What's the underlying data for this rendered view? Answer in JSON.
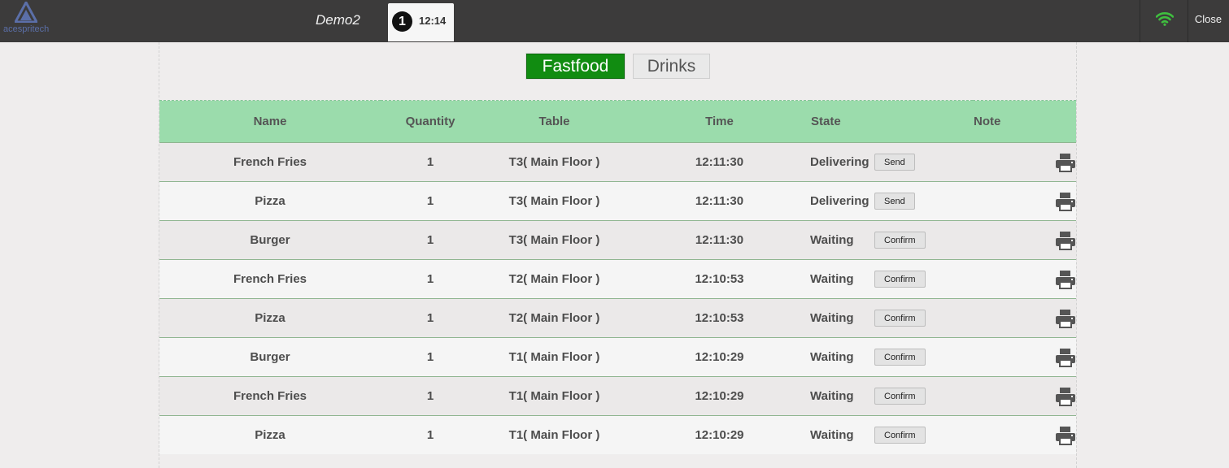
{
  "header": {
    "logo_text": "acespritech",
    "user_name": "Demo2",
    "badge_count": "1",
    "clock": "12:14",
    "close_label": "Close",
    "wifi_color": "#3fbf3f"
  },
  "tabs": [
    {
      "label": "Fastfood",
      "active": true
    },
    {
      "label": "Drinks",
      "active": false
    }
  ],
  "table": {
    "columns": [
      "Name",
      "Quantity",
      "Table",
      "Time",
      "State",
      "Note"
    ],
    "rows": [
      {
        "name": "French Fries",
        "qty": "1",
        "table": "T3( Main Floor )",
        "time": "12:11:30",
        "state": "Delivering",
        "action": "Send"
      },
      {
        "name": "Pizza",
        "qty": "1",
        "table": "T3( Main Floor )",
        "time": "12:11:30",
        "state": "Delivering",
        "action": "Send"
      },
      {
        "name": "Burger",
        "qty": "1",
        "table": "T3( Main Floor )",
        "time": "12:11:30",
        "state": "Waiting",
        "action": "Confirm"
      },
      {
        "name": "French Fries",
        "qty": "1",
        "table": "T2( Main Floor )",
        "time": "12:10:53",
        "state": "Waiting",
        "action": "Confirm"
      },
      {
        "name": "Pizza",
        "qty": "1",
        "table": "T2( Main Floor )",
        "time": "12:10:53",
        "state": "Waiting",
        "action": "Confirm"
      },
      {
        "name": "Burger",
        "qty": "1",
        "table": "T1( Main Floor )",
        "time": "12:10:29",
        "state": "Waiting",
        "action": "Confirm"
      },
      {
        "name": "French Fries",
        "qty": "1",
        "table": "T1( Main Floor )",
        "time": "12:10:29",
        "state": "Waiting",
        "action": "Confirm"
      },
      {
        "name": "Pizza",
        "qty": "1",
        "table": "T1( Main Floor )",
        "time": "12:10:29",
        "state": "Waiting",
        "action": "Confirm"
      }
    ],
    "note_icon": "printer-icon"
  },
  "colors": {
    "active_tab": "#118c11",
    "header_row": "#9bdcac",
    "topbar": "#3c3b3b"
  }
}
